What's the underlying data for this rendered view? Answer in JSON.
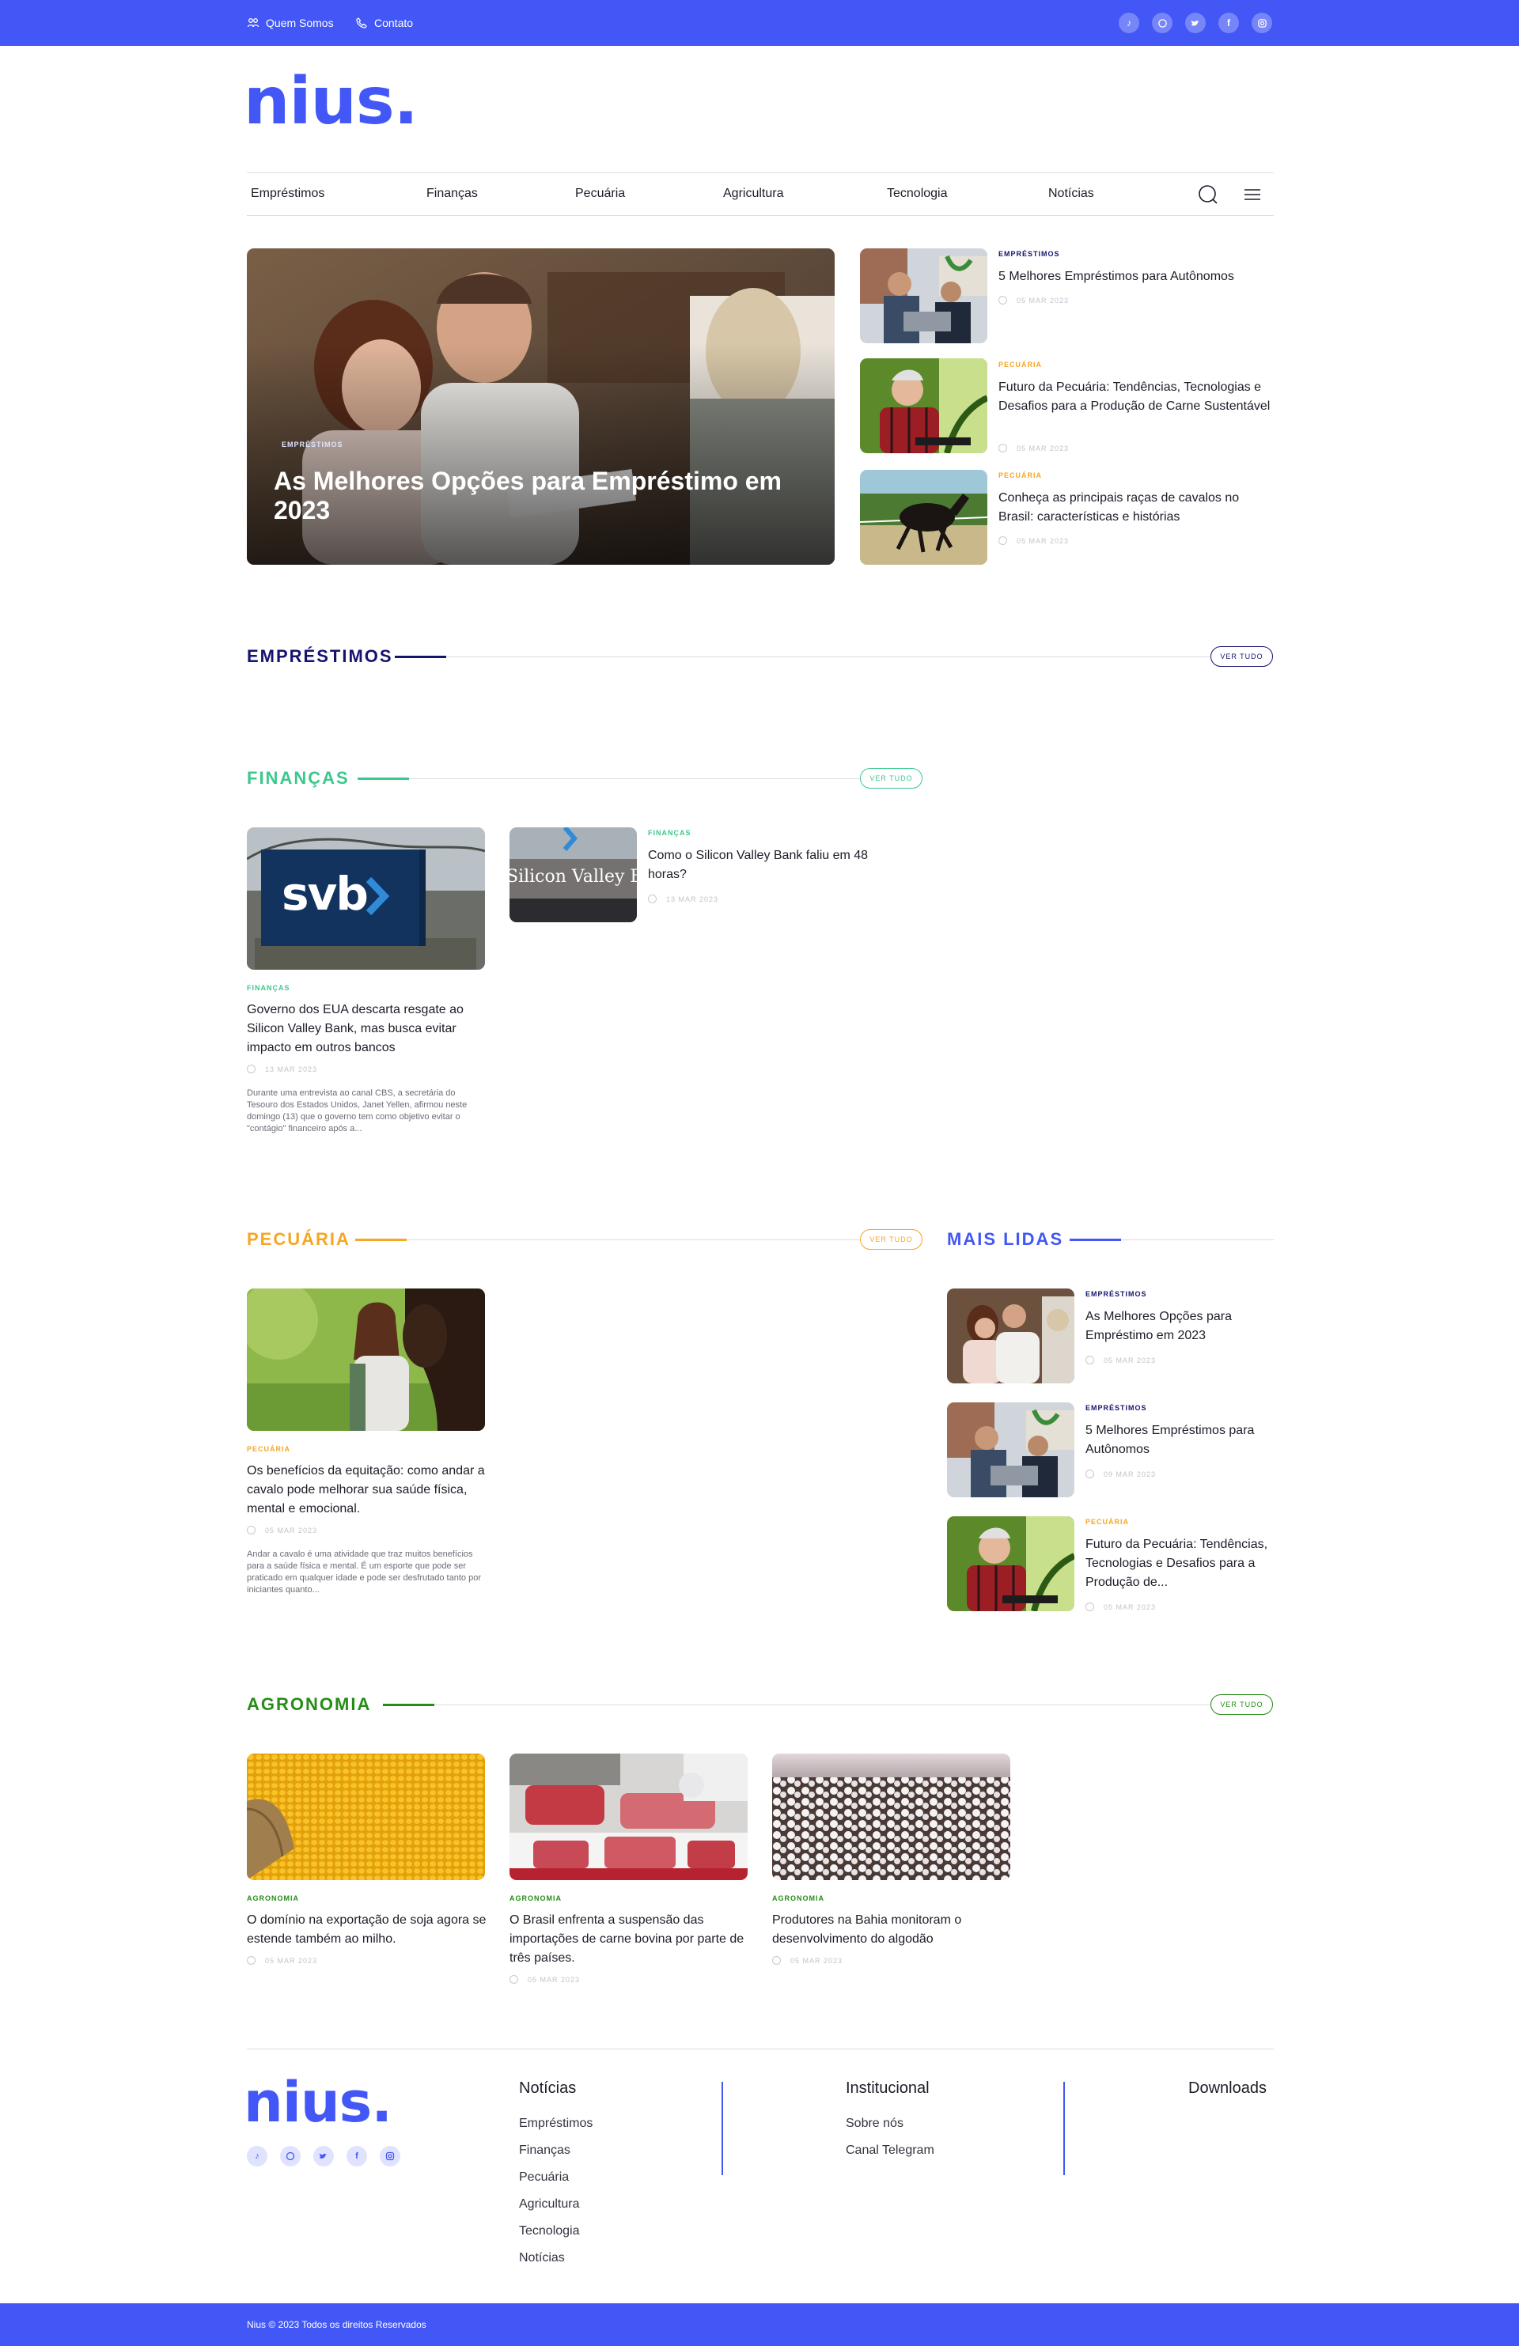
{
  "topbar": {
    "links": [
      "Quem Somos",
      "Contato"
    ],
    "social_icons": [
      "tiktok-icon",
      "whatsapp-icon",
      "twitter-icon",
      "facebook-icon",
      "instagram-icon"
    ]
  },
  "brand": {
    "logo": "nius.",
    "color": "#4257f5"
  },
  "nav": {
    "items": [
      "Empréstimos",
      "Finanças",
      "Pecuária",
      "Agricultura",
      "Tecnologia",
      "Notícias"
    ],
    "icons": [
      "search-icon",
      "menu-icon"
    ]
  },
  "colors": {
    "emprestimos": "#14146e",
    "financas": "#3cc88c",
    "pecuaria": "#f5a623",
    "mais_lidas": "#4257f5",
    "agronomia": "#258c16"
  },
  "hero": {
    "category": "EMPRÉSTIMOS",
    "title": "As Melhores Opções para Empréstimo em 2023"
  },
  "hero_side": [
    {
      "category": "EMPRÉSTIMOS",
      "title": "5 Melhores Empréstimos para Autônomos",
      "date": "05 MAR 2023"
    },
    {
      "category": "PECUÁRIA",
      "title": "Futuro da Pecuária: Tendências, Tecnologias e Desafios para a Produção de Carne Sustentável",
      "date": "05 MAR 2023"
    },
    {
      "category": "PECUÁRIA",
      "title": "Conheça as principais raças de cavalos no Brasil: características e histórias",
      "date": "05 MAR 2023"
    }
  ],
  "sections": {
    "emprestimos": {
      "title": "EMPRÉSTIMOS",
      "more": "VER TUDO"
    },
    "financas": {
      "title": "FINANÇAS",
      "more": "VER TUDO"
    },
    "pecuaria": {
      "title": "PECUÁRIA",
      "more": "VER TUDO"
    },
    "mais_lidas": {
      "title": "MAIS LIDAS"
    },
    "agronomia": {
      "title": "AGRONOMIA",
      "more": "VER TUDO"
    }
  },
  "financas": {
    "main": {
      "image_text": "svb",
      "category": "FINANÇAS",
      "title": "Governo dos EUA descarta resgate ao Silicon Valley Bank, mas busca evitar impacto em outros bancos",
      "date": "13 MAR 2023",
      "excerpt": "Durante uma entrevista ao canal CBS, a secretária do Tesouro dos Estados Unidos, Janet Yellen, afirmou neste domingo (13) que o governo tem como objetivo evitar o \"contágio\" financeiro após a..."
    },
    "side": {
      "image_text": "Silicon Valley Ban",
      "category": "FINANÇAS",
      "title": "Como o Silicon Valley Bank faliu em 48 horas?",
      "date": "13 MAR 2023"
    }
  },
  "pecuaria": {
    "main": {
      "category": "PECUÁRIA",
      "title": "Os benefícios da equitação: como andar a cavalo pode melhorar sua saúde física, mental e emocional.",
      "date": "05 MAR 2023",
      "excerpt": "Andar a cavalo é uma atividade que traz muitos benefícios para a saúde física e mental. É um esporte que pode ser praticado em qualquer idade e pode ser desfrutado tanto por iniciantes quanto..."
    }
  },
  "mais_lidas": [
    {
      "category": "EMPRÉSTIMOS",
      "title": "As Melhores Opções para Empréstimo em 2023",
      "date": "05 MAR 2023"
    },
    {
      "category": "EMPRÉSTIMOS",
      "title": "5 Melhores Empréstimos para Autônomos",
      "date": "09 MAR 2023"
    },
    {
      "category": "PECUÁRIA",
      "title": "Futuro da Pecuária: Tendências, Tecnologias e Desafios para a Produção de...",
      "date": "05 MAR 2023"
    }
  ],
  "agronomia": [
    {
      "category": "AGRONOMIA",
      "title": "O domínio na exportação de soja agora se estende também ao milho.",
      "date": "05 MAR 2023"
    },
    {
      "category": "AGRONOMIA",
      "title": "O Brasil enfrenta a suspensão das importações de carne bovina por parte de três países.",
      "date": "05 MAR 2023"
    },
    {
      "category": "AGRONOMIA",
      "title": "Produtores na Bahia monitoram o desenvolvimento do algodão",
      "date": "05 MAR 2023"
    }
  ],
  "footer": {
    "logo": "nius.",
    "col1": {
      "title": "Notícias",
      "links": [
        "Empréstimos",
        "Finanças",
        "Pecuária",
        "Agricultura",
        "Tecnologia",
        "Notícias"
      ]
    },
    "col2": {
      "title": "Institucional",
      "links": [
        "Sobre nós",
        "Canal Telegram"
      ]
    },
    "col3": {
      "title": "Downloads"
    },
    "copyright": "Nius © 2023 Todos os direitos Reservados"
  }
}
